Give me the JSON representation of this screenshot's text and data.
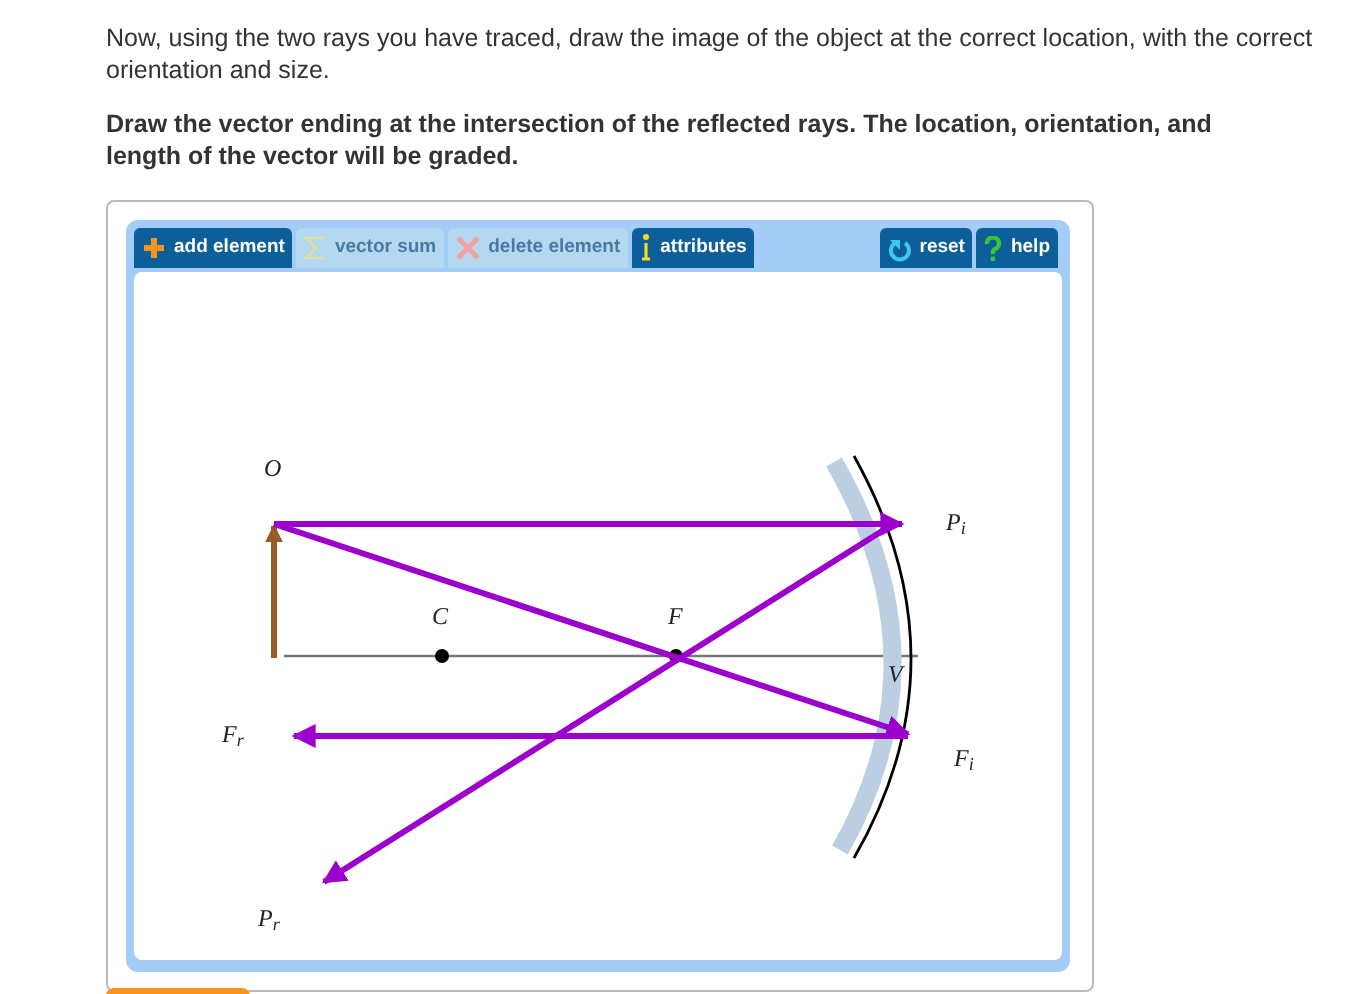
{
  "instructions": "Now, using the two rays you have traced, draw the image of the object at the correct location, with the correct orientation and size.",
  "task": "Draw the vector ending at the intersection of the reflected rays. The location, orientation, and length of the vector will be graded.",
  "toolbar": {
    "left": [
      {
        "label": "add element",
        "disabled": false
      },
      {
        "label": "vector sum",
        "disabled": true
      },
      {
        "label": "delete element",
        "disabled": true
      },
      {
        "label": "attributes",
        "disabled": false
      }
    ],
    "right": [
      {
        "label": "reset",
        "disabled": false
      },
      {
        "label": "help",
        "disabled": false
      }
    ]
  },
  "diagram": {
    "labels": [
      {
        "kind": "object",
        "text": "O"
      },
      {
        "kind": "parallel_incident",
        "text": "P$_{i}$"
      },
      {
        "kind": "center",
        "text": "C"
      },
      {
        "kind": "focus",
        "text": "F"
      },
      {
        "kind": "vertex",
        "text": "V"
      },
      {
        "kind": "focal_reflected",
        "text": "F$_{r}$"
      },
      {
        "kind": "focal_incident",
        "text": "F$_{i}$"
      },
      {
        "kind": "parallel_reflected",
        "text": "P$_{r}$"
      }
    ]
  }
}
